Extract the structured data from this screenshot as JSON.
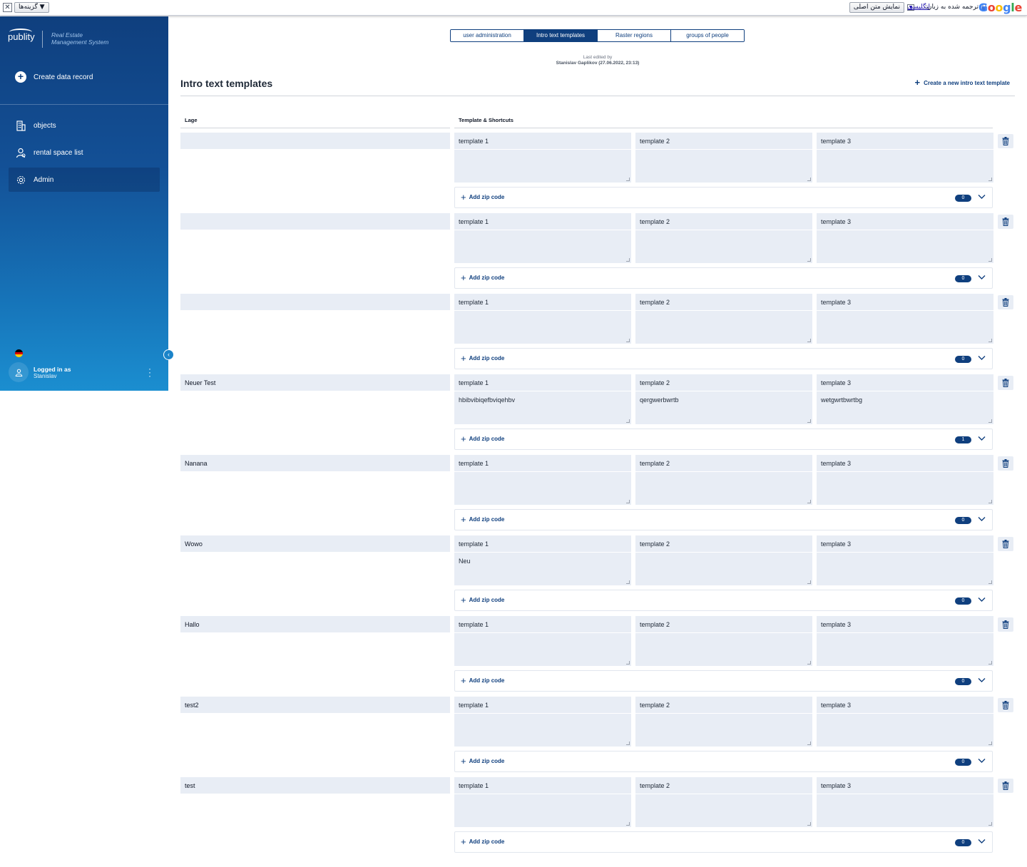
{
  "translate_bar": {
    "close": "✕",
    "options_label": "گزینه‌ها ▼",
    "show_original_label": "نمایش متن اصلی",
    "language_link": "انگلیسی",
    "translated_to_label": "ترجمه شده به زبان:",
    "google_letters": [
      "G",
      "o",
      "o",
      "g",
      "l",
      "e"
    ]
  },
  "sidebar": {
    "logo": "publity",
    "logo_sub_1": "Real Estate",
    "logo_sub_2": "Management System",
    "create_record": "Create data record",
    "nav": [
      {
        "label": "objects",
        "icon": "building-icon"
      },
      {
        "label": "rental space list",
        "icon": "person-search-icon"
      },
      {
        "label": "Admin",
        "icon": "gear-icon",
        "active": true
      }
    ],
    "user_line1": "Logged in as",
    "user_line2": "Stanislav"
  },
  "tabs": [
    {
      "label": "user administration",
      "active": false
    },
    {
      "label": "Intro text templates",
      "active": true
    },
    {
      "label": "Raster regions",
      "active": false
    },
    {
      "label": "groups of people",
      "active": false
    }
  ],
  "last_edited": {
    "label": "Last edited by",
    "by": "Stanislav Gaplikov (27.06.2022, 23:13)"
  },
  "page_title": "Intro text templates",
  "create_template": "Create a new intro text template",
  "columns": {
    "lage": "Lage",
    "templates": "Template & Shortcuts"
  },
  "template_labels": [
    "template 1",
    "template 2",
    "template 3"
  ],
  "add_zip": "Add zip code",
  "rows": [
    {
      "lage": "",
      "values": [
        "",
        "",
        ""
      ],
      "count": "0"
    },
    {
      "lage": "",
      "values": [
        "",
        "",
        ""
      ],
      "count": "0"
    },
    {
      "lage": "",
      "values": [
        "",
        "",
        ""
      ],
      "count": "0"
    },
    {
      "lage": "Neuer Test",
      "values": [
        "hbibvibiqefbviqehbv",
        "qergwerbwrtb",
        "wetgwrtbwrtbg"
      ],
      "count": "1"
    },
    {
      "lage": "Nanana",
      "values": [
        "",
        "",
        ""
      ],
      "count": "0"
    },
    {
      "lage": "Wowo",
      "values": [
        "Neu",
        "",
        ""
      ],
      "count": "0"
    },
    {
      "lage": "Hallo",
      "values": [
        "",
        "",
        ""
      ],
      "count": "0"
    },
    {
      "lage": "test2",
      "values": [
        "",
        "",
        ""
      ],
      "count": "0"
    },
    {
      "lage": "test",
      "values": [
        "",
        "",
        ""
      ],
      "count": "0"
    }
  ],
  "colors": {
    "primary": "#0f3f7e",
    "field_bg": "#e8edf5",
    "sidebar_top": "#0f3f7e",
    "sidebar_bottom": "#1b8ed0"
  }
}
